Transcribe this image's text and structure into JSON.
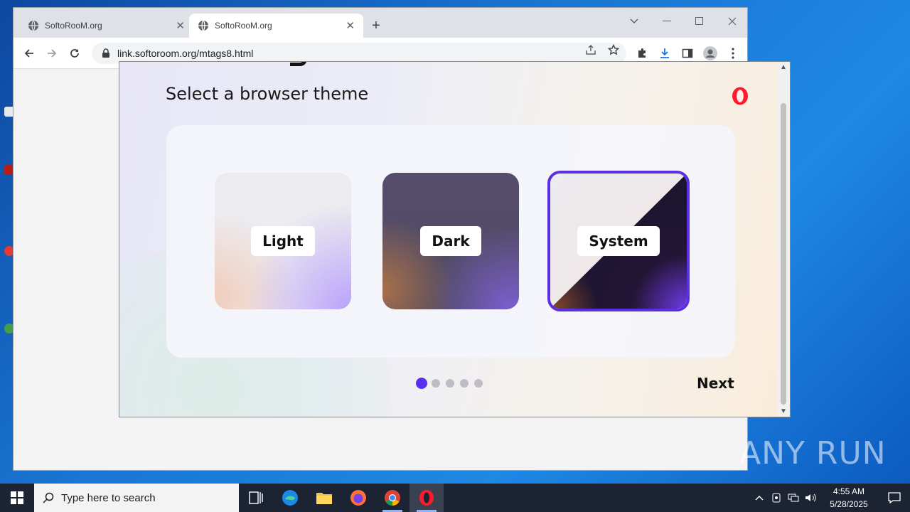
{
  "browser": {
    "tabs": [
      {
        "title": "SoftoRooM.org",
        "active": false
      },
      {
        "title": "SoftoRooM.org",
        "active": true
      }
    ],
    "url": "link.softoroom.org/mtags8.html"
  },
  "installer": {
    "title": "Select a browser theme",
    "themes": [
      {
        "label": "Light",
        "selected": false
      },
      {
        "label": "Dark",
        "selected": false
      },
      {
        "label": "System",
        "selected": true
      }
    ],
    "steps_total": 5,
    "step_current": 1,
    "next_label": "Next",
    "accent_color": "#5a2ef0"
  },
  "watermark": {
    "text": "ANY RUN"
  },
  "taskbar": {
    "search_placeholder": "Type here to search",
    "time": "4:55 AM",
    "date": "5/28/2025"
  }
}
